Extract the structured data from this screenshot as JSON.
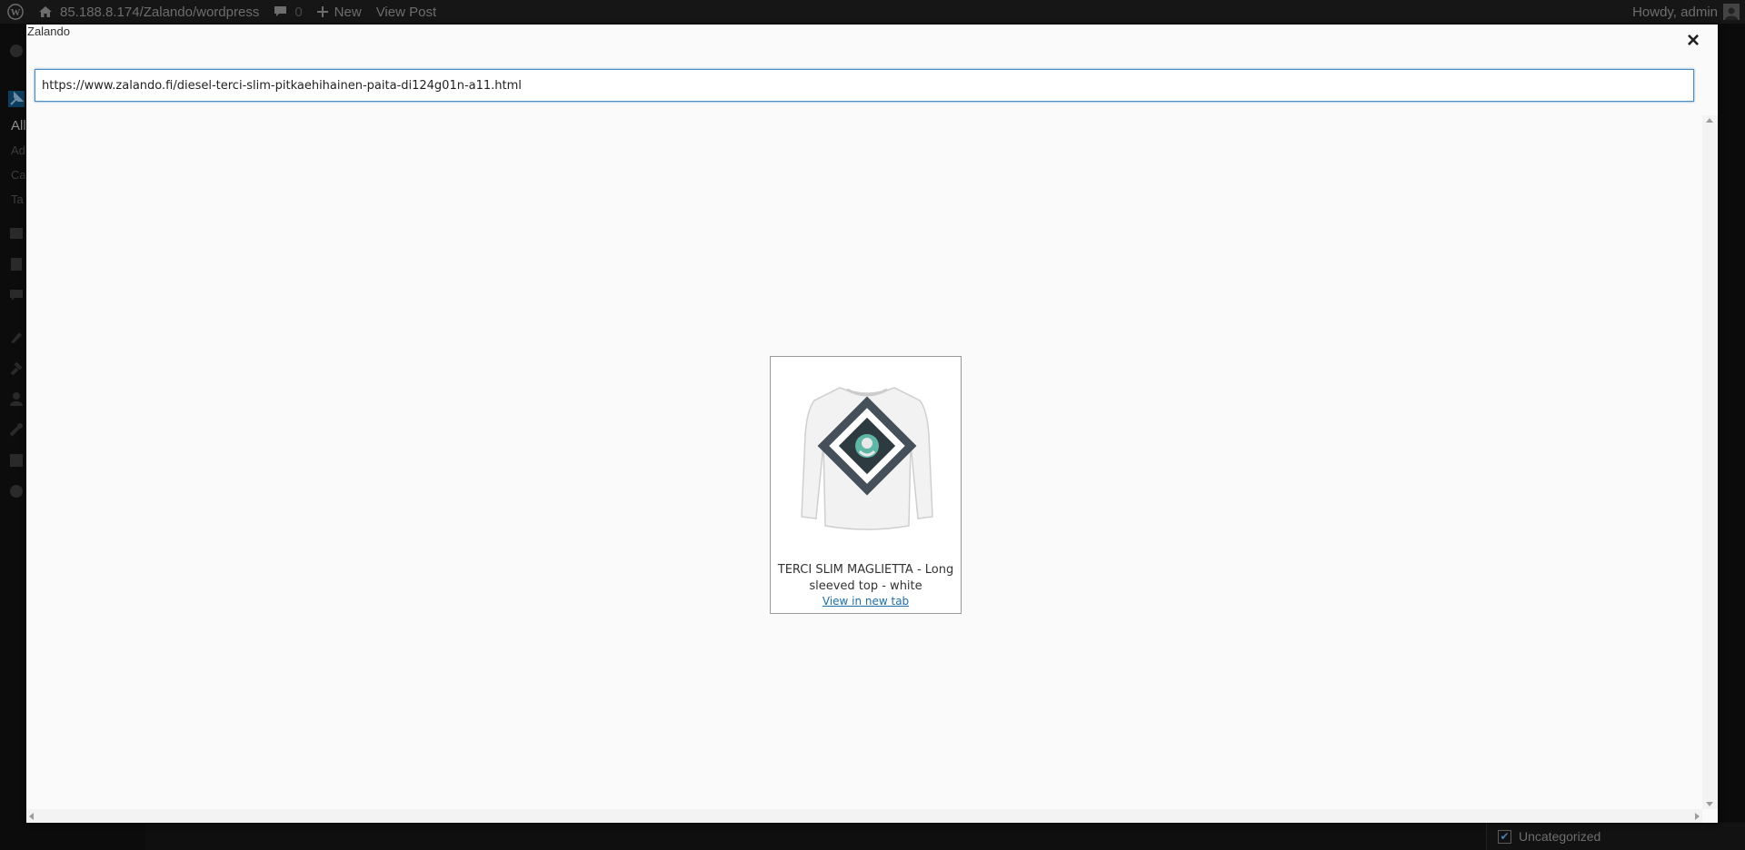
{
  "admin_bar": {
    "site_url": "85.188.8.174/Zalando/wordpress",
    "comments_count": "0",
    "new_label": "New",
    "view_post_label": "View Post",
    "greeting": "Howdy, admin"
  },
  "admin_menu": {
    "posts_submenu": [
      "All",
      "Ad",
      "Ca",
      "Ta"
    ]
  },
  "categories": {
    "item": "Uncategorized",
    "checked": true
  },
  "modal": {
    "title": "Zalando",
    "close_symbol": "×",
    "url_value": "https://www.zalando.fi/diesel-terci-slim-pitkaehihainen-paita-di124g01n-a11.html"
  },
  "product": {
    "image_alt": "white long sleeve t-shirt with Diesel 'BORN TO BE BRAVE' print",
    "name": "TERCI SLIM MAGLIETTA - Long sleeved top - white",
    "link_label": "View in new tab"
  }
}
